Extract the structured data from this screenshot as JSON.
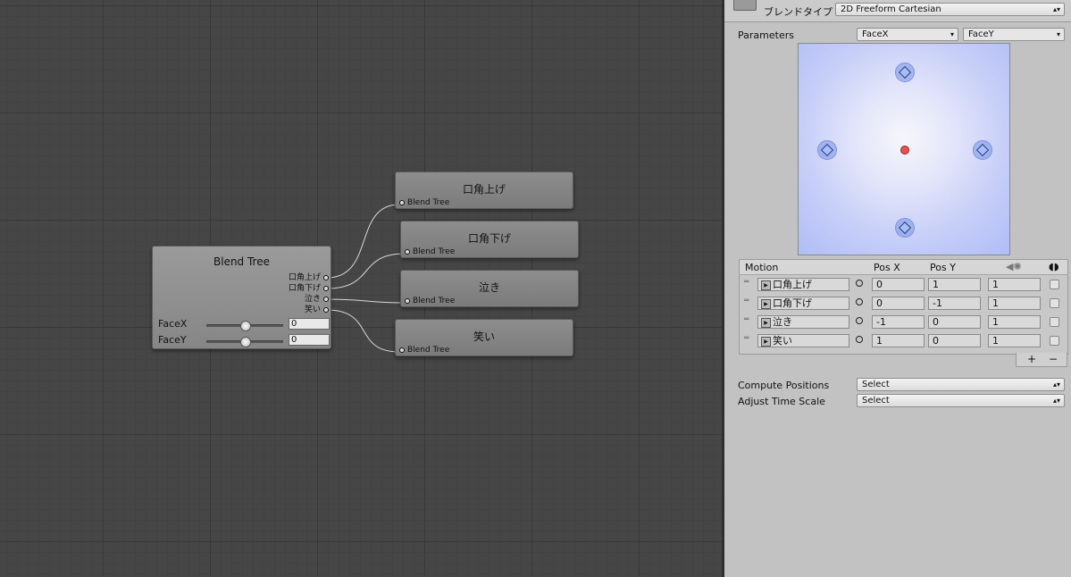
{
  "graph": {
    "blend_node": {
      "title": "Blend Tree",
      "outputs": [
        "口角上げ",
        "口角下げ",
        "泣き",
        "笑い"
      ],
      "params": [
        {
          "name": "FaceX",
          "value": "0",
          "slider_level": 0.5
        },
        {
          "name": "FaceY",
          "value": "0",
          "slider_level": 0.5
        }
      ]
    },
    "child_nodes": [
      {
        "title": "口角上げ",
        "port": "Blend Tree"
      },
      {
        "title": "口角下げ",
        "port": "Blend Tree"
      },
      {
        "title": "泣き",
        "port": "Blend Tree"
      },
      {
        "title": "笑い",
        "port": "Blend Tree"
      }
    ]
  },
  "inspector": {
    "blend_type_label": "ブレンドタイプ",
    "blend_type_value": "2D Freeform Cartesian",
    "parameters_label": "Parameters",
    "param_x": "FaceX",
    "param_y": "FaceY",
    "motion_header": {
      "motion": "Motion",
      "pos_x": "Pos X",
      "pos_y": "Pos Y"
    },
    "motions": [
      {
        "name": "口角上げ",
        "pos_x": "0",
        "pos_y": "1",
        "speed": "1"
      },
      {
        "name": "口角下げ",
        "pos_x": "0",
        "pos_y": "-1",
        "speed": "1"
      },
      {
        "name": "泣き",
        "pos_x": "-1",
        "pos_y": "0",
        "speed": "1"
      },
      {
        "name": "笑い",
        "pos_x": "1",
        "pos_y": "0",
        "speed": "1"
      }
    ],
    "add_label": "+",
    "remove_label": "−",
    "compute_positions_label": "Compute Positions",
    "compute_positions_value": "Select",
    "adjust_time_scale_label": "Adjust Time Scale",
    "adjust_time_scale_value": "Select"
  },
  "colors": {
    "graph_bg": "#464646",
    "node_bg": "#8a8a8a",
    "inspector_bg": "#c2c2c2",
    "plot_blue": "#b0bcf6",
    "current_point": "#e55151"
  }
}
